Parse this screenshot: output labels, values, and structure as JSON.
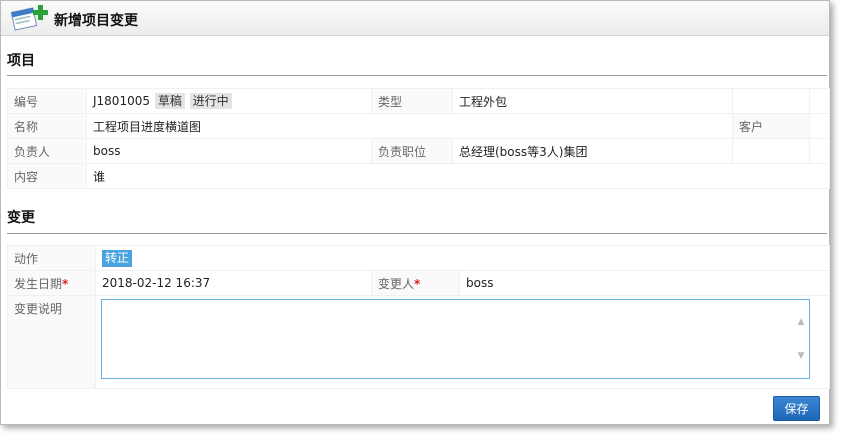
{
  "dialog": {
    "title": "新增项目变更"
  },
  "project_section": {
    "heading": "项目",
    "fields": {
      "code_label": "编号",
      "code_value": "J1801005",
      "status_tag_1": "草稿",
      "status_tag_2": "进行中",
      "type_label": "类型",
      "type_value": "工程外包",
      "name_label": "名称",
      "name_value": "工程项目进度横道图",
      "customer_label": "客户",
      "customer_value": "",
      "owner_label": "负责人",
      "owner_value": "boss",
      "position_label": "负责职位",
      "position_value": "总经理(boss等3人)集团",
      "content_label": "内容",
      "content_value": "谁"
    }
  },
  "change_section": {
    "heading": "变更",
    "fields": {
      "action_label": "动作",
      "action_value": "转正",
      "date_label": "发生日期",
      "date_value": "2018-02-12 16:37",
      "changer_label": "变更人",
      "changer_value": "boss",
      "desc_label": "变更说明",
      "desc_value": "",
      "required_mark": "*"
    }
  },
  "buttons": {
    "save": "保存"
  }
}
